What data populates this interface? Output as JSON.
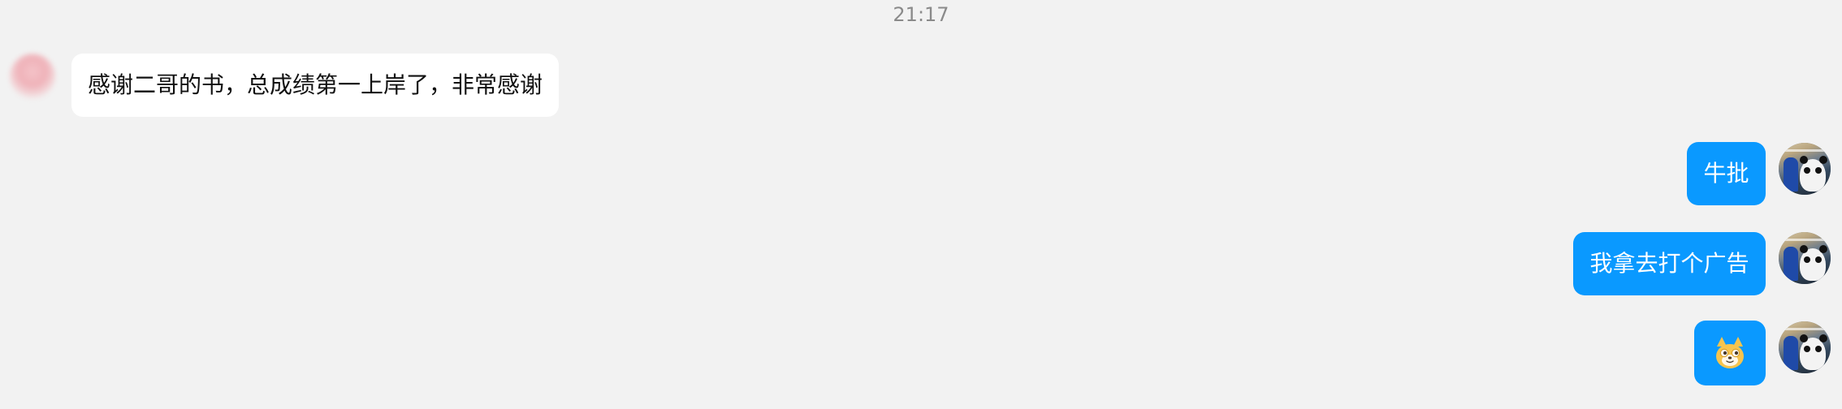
{
  "time": "21:17",
  "messages": [
    {
      "side": "left",
      "text": "感谢二哥的书，总成绩第一上岸了，非常感谢"
    },
    {
      "side": "right",
      "text": "牛批"
    },
    {
      "side": "right",
      "text": "我拿去打个广告"
    },
    {
      "side": "right",
      "type": "emoji",
      "emoji": "dog-emoji-icon"
    }
  ],
  "colors": {
    "background": "#f2f2f2",
    "incoming_bubble": "#ffffff",
    "outgoing_bubble": "#0a99ff",
    "timestamp": "#8a8a8a"
  }
}
